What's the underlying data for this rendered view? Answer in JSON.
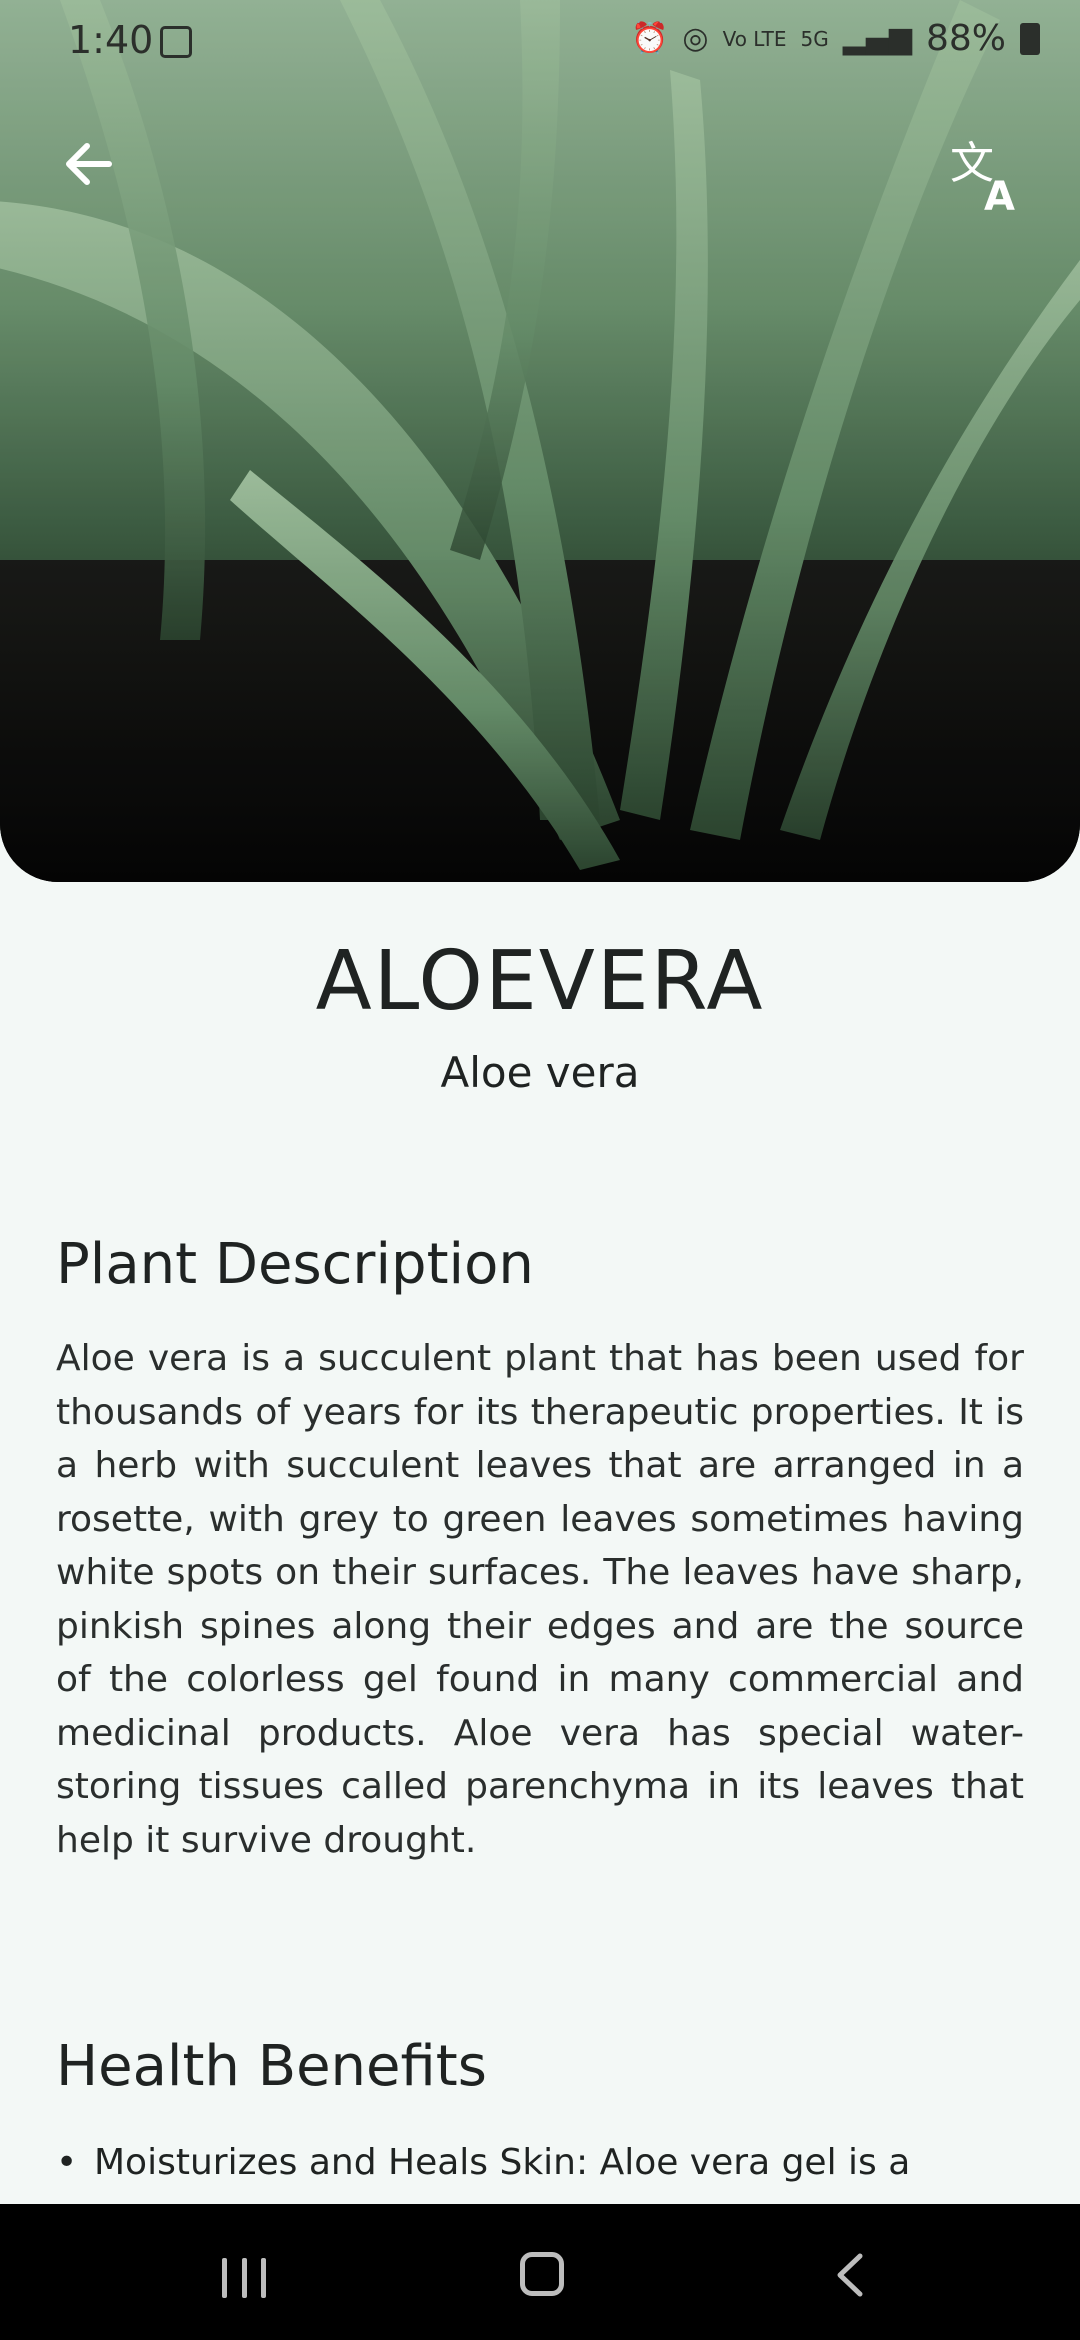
{
  "status_bar": {
    "time": "1:40",
    "battery": "88%",
    "icons": [
      "image-icon",
      "alarm-icon",
      "hotspot-icon",
      "volte-icon",
      "5g-icon",
      "signal-icon",
      "battery-icon"
    ]
  },
  "header": {
    "back_icon": "arrow-left-icon",
    "translate_icon": "translate-icon"
  },
  "plant": {
    "common_name": "ALOEVERA",
    "scientific_name": "Aloe vera"
  },
  "sections": {
    "description": {
      "heading": "Plant Description",
      "text": "Aloe vera is a succulent plant that has been used for thousands of years for its therapeutic properties. It is a herb with succulent leaves that are arranged in a rosette, with grey to green leaves sometimes having white spots on their surfaces. The leaves have sharp, pinkish spines along their edges and are the source of the colorless gel found in many commercial and medicinal products. Aloe vera has special water-storing tissues called parenchyma in its leaves that help it survive drought."
    },
    "health": {
      "heading": "Health Benefits",
      "items": [
        "Moisturizes and Heals Skin: Aloe vera gel is a"
      ]
    }
  },
  "nav_bar": {
    "icons": [
      "recents-icon",
      "home-icon",
      "back-icon"
    ]
  },
  "colors": {
    "background": "#f3f8f6",
    "text": "#1f2322",
    "leaf": "#6f9a73"
  }
}
